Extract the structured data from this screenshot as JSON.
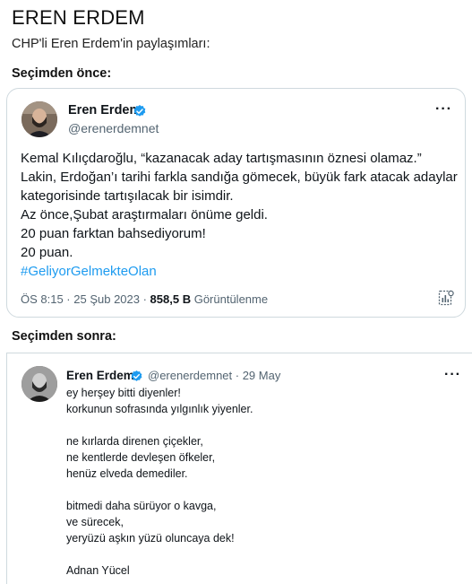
{
  "page": {
    "title": "EREN ERDEM",
    "intro": "CHP'li Eren Erdem'in paylaşımları:",
    "before_label": "Seçimden önce:",
    "after_label": "Seçimden sonra:"
  },
  "colors": {
    "link": "#1d9bf0",
    "verified": "#1d9bf0",
    "border": "#cfd9de",
    "muted": "#536471"
  },
  "tweet1": {
    "name": "Eren Erdem",
    "handle": "@erenerdemnet",
    "more": "···",
    "lines": [
      "Kemal Kılıçdaroğlu, “kazanacak aday tartışmasının öznesi olamaz.”",
      "Lakin, Erdoğan’ı tarihi farkla sandığa gömecek, büyük fark atacak adaylar",
      "kategorisinde tartışılacak bir isimdir.",
      "Az önce,Şubat araştırmaları önüme geldi.",
      "20 puan farktan bahsediyorum!",
      "20 puan."
    ],
    "hashtag": "#GeliyorGelmekteOlan",
    "timestamp": "ÖS 8:15 · 25 Şub 2023 · ",
    "views": "858,5 B",
    "views_label": " Görüntülenme"
  },
  "tweet2": {
    "name": "Eren Erdem",
    "handle_date": "@erenerdemnet · 29 May",
    "more": "···",
    "lines": [
      "ey herşey bitti diyenler!",
      "korkunun sofrasında yılgınlık yiyenler.",
      "",
      "ne kırlarda direnen çiçekler,",
      "ne kentlerde devleşen öfkeler,",
      "henüz elveda demediler.",
      "",
      "bitmedi daha sürüyor o kavga,",
      "ve sürecek,",
      "yeryüzü aşkın yüzü oluncaya dek!",
      "",
      "Adnan Yücel"
    ]
  }
}
